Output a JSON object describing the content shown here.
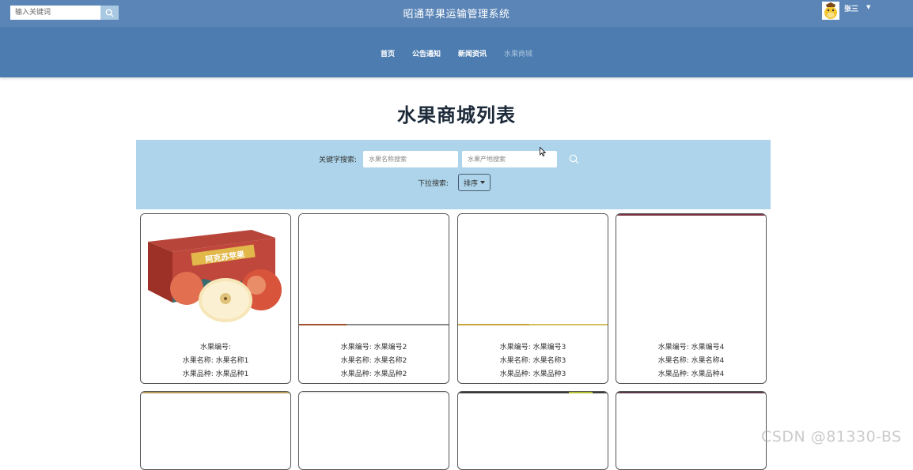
{
  "header": {
    "search_placeholder": "输入关键词",
    "site_title": "昭通苹果运输管理系统",
    "user_name": "张三"
  },
  "nav": {
    "items": [
      {
        "label": "首页"
      },
      {
        "label": "公告通知"
      },
      {
        "label": "新闻资讯"
      },
      {
        "label": "水果商城"
      }
    ],
    "active_index": 3
  },
  "page": {
    "heading": "水果商城列表"
  },
  "filter": {
    "keyword_label": "关键字搜索:",
    "name_placeholder": "水果名称搜索",
    "origin_placeholder": "水果产地搜索",
    "dropdown_label": "下拉搜索:",
    "sort_label": "排序"
  },
  "products": [
    {
      "code": "水果编号:",
      "name": "水果名称: 水果名称1",
      "variety": "水果品种: 水果品种1"
    },
    {
      "code": "水果编号: 水果编号2",
      "name": "水果名称: 水果名称2",
      "variety": "水果品种: 水果品种2"
    },
    {
      "code": "水果编号: 水果编号3",
      "name": "水果名称: 水果名称3",
      "variety": "水果品种: 水果品种3"
    },
    {
      "code": "水果编号: 水果编号4",
      "name": "水果名称: 水果名称4",
      "variety": "水果品种: 水果品种4"
    }
  ],
  "watermark": "CSDN @81330-BS",
  "colors": {
    "topbar": "#5b85b7",
    "navband": "#4d7db0",
    "filter_panel": "#add4ea",
    "nav_active": "#a9c3dd"
  }
}
